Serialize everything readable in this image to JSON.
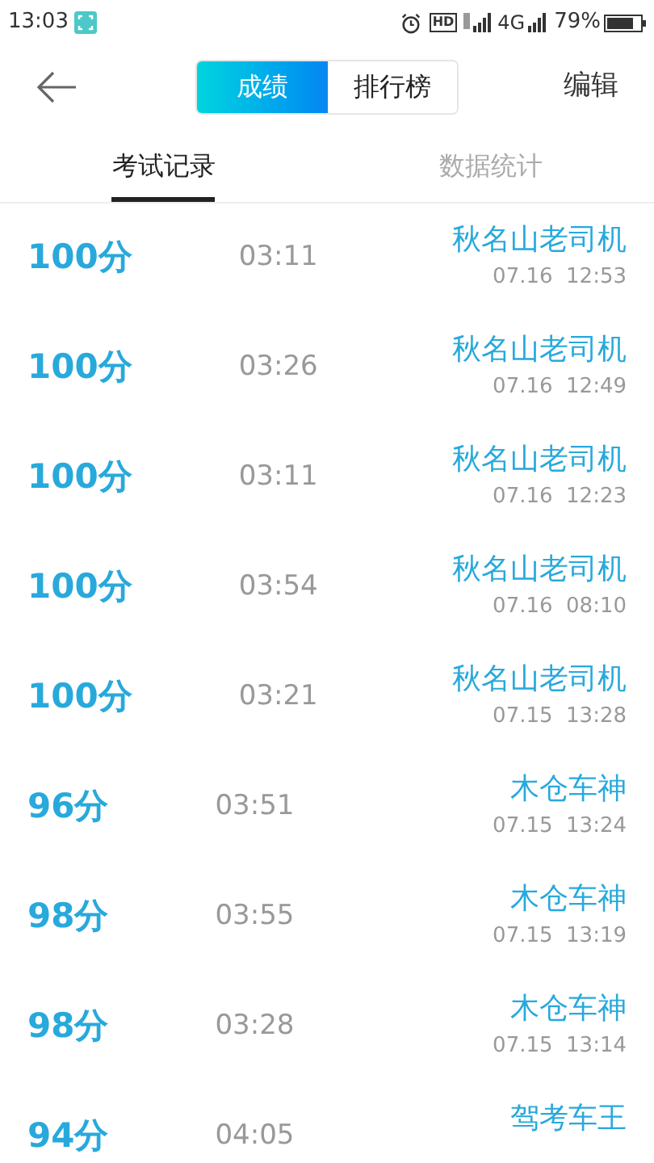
{
  "status_bar": {
    "time": "13:03",
    "hd": "HD",
    "network": "4G",
    "battery_text": "79%"
  },
  "header": {
    "segments": [
      {
        "label": "成绩",
        "selected": true
      },
      {
        "label": "排行榜",
        "selected": false
      }
    ],
    "action": "编辑"
  },
  "tabs": [
    {
      "label": "考试记录",
      "selected": true
    },
    {
      "label": "数据统计",
      "selected": false
    }
  ],
  "records": [
    {
      "score": "100分",
      "duration": "03:11",
      "name": "秋名山老司机",
      "date": "07.16  12:53"
    },
    {
      "score": "100分",
      "duration": "03:26",
      "name": "秋名山老司机",
      "date": "07.16  12:49"
    },
    {
      "score": "100分",
      "duration": "03:11",
      "name": "秋名山老司机",
      "date": "07.16  12:23"
    },
    {
      "score": "100分",
      "duration": "03:54",
      "name": "秋名山老司机",
      "date": "07.16  08:10"
    },
    {
      "score": "100分",
      "duration": "03:21",
      "name": "秋名山老司机",
      "date": "07.15  13:28"
    },
    {
      "score": "96分",
      "duration": "03:51",
      "name": "木仓车神",
      "date": "07.15  13:24"
    },
    {
      "score": "98分",
      "duration": "03:55",
      "name": "木仓车神",
      "date": "07.15  13:19"
    },
    {
      "score": "98分",
      "duration": "03:28",
      "name": "木仓车神",
      "date": "07.15  13:14"
    },
    {
      "score": "94分",
      "duration": "04:05",
      "name": "驾考车王"
    }
  ]
}
